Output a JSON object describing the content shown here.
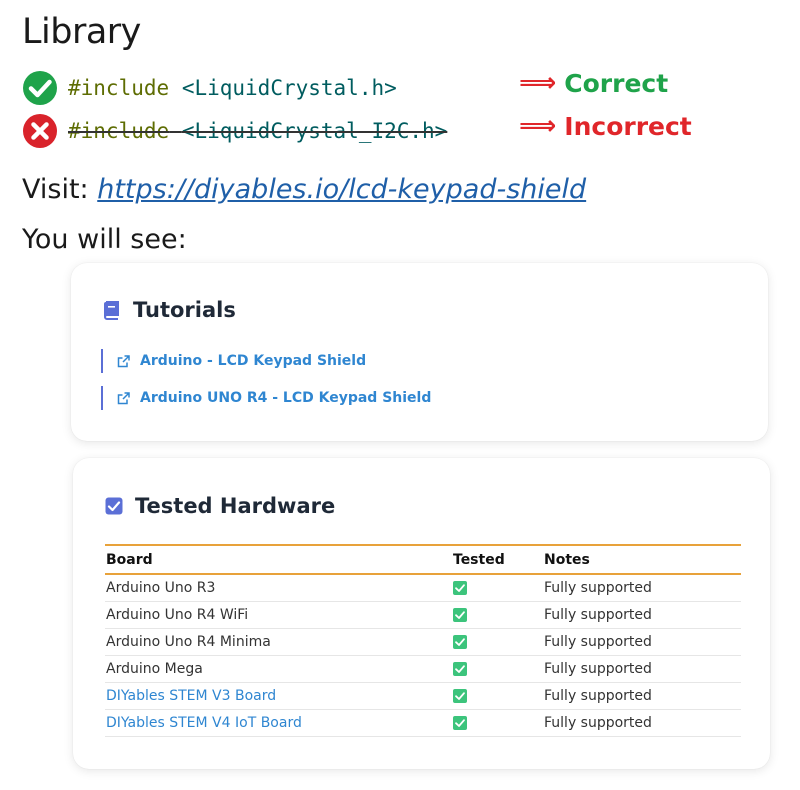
{
  "heading": "Library",
  "lines": [
    {
      "keyword": "#include",
      "header": "<LiquidCrystal.h>",
      "verdict": "Correct"
    },
    {
      "keyword": "#include",
      "header": "<LiquidCrystal_I2C.h>",
      "verdict": "Incorrect"
    }
  ],
  "visit": {
    "label": "Visit:",
    "url": "https://diyables.io/lcd-keypad-shield"
  },
  "see_label": "You will see:",
  "tutorials": {
    "title": "Tutorials",
    "icon": "book-icon",
    "links": [
      "Arduino - LCD Keypad Shield",
      "Arduino UNO R4 - LCD Keypad Shield"
    ]
  },
  "hardware": {
    "title": "Tested Hardware",
    "icon": "checkbox-icon",
    "columns": [
      "Board",
      "Tested",
      "Notes"
    ],
    "rows": [
      {
        "board": "Arduino Uno R3",
        "notes": "Fully supported",
        "link": false
      },
      {
        "board": "Arduino Uno R4 WiFi",
        "notes": "Fully supported",
        "link": false
      },
      {
        "board": "Arduino Uno R4 Minima",
        "notes": "Fully supported",
        "link": false
      },
      {
        "board": "Arduino Mega",
        "notes": "Fully supported",
        "link": false
      },
      {
        "board": "DIYables STEM V3 Board",
        "notes": "Fully supported",
        "link": true
      },
      {
        "board": "DIYables STEM V4 IoT Board",
        "notes": "Fully supported",
        "link": true
      }
    ]
  },
  "colors": {
    "correct": "#1fa34a",
    "incorrect": "#e0262a",
    "link": "#2f86d1",
    "table_rule": "#e8a23a"
  }
}
